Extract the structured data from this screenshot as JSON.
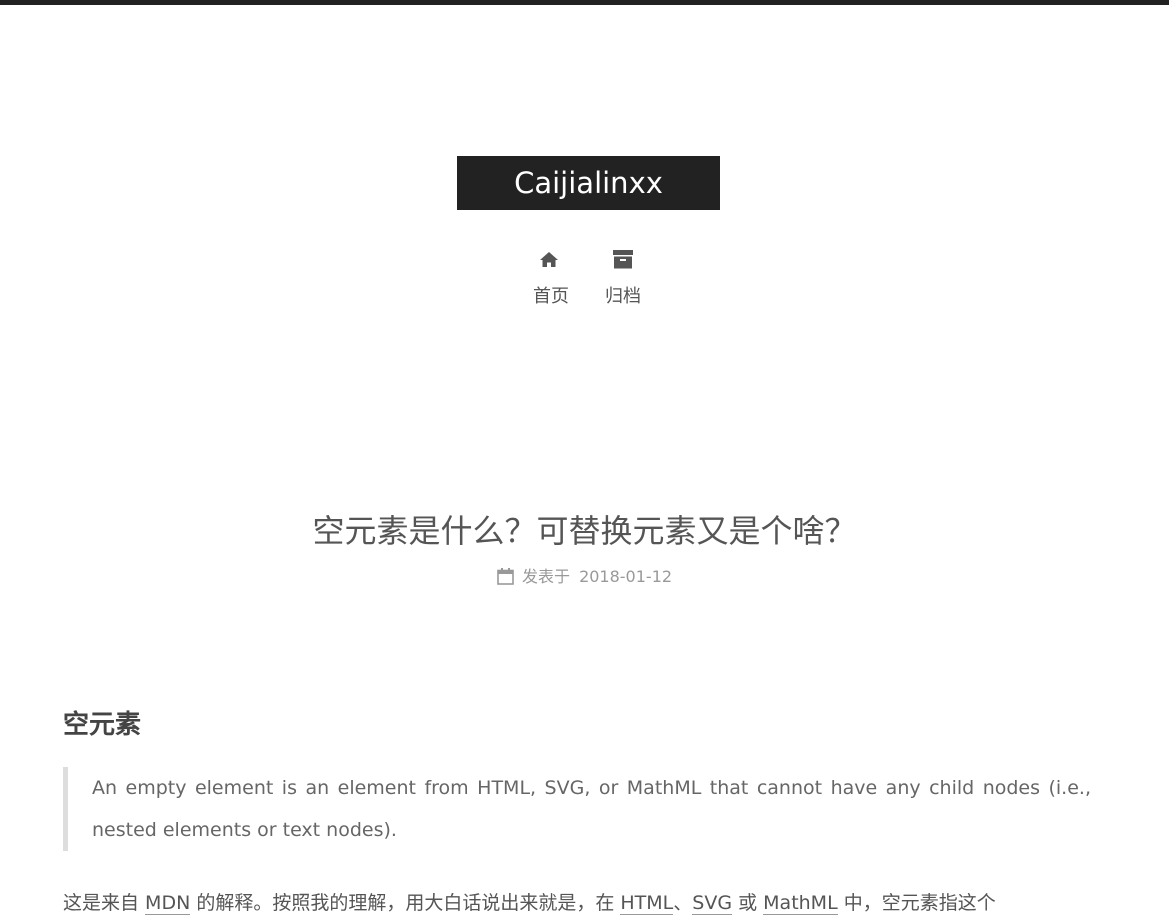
{
  "site": {
    "brand": "Caijialinxx"
  },
  "menu": {
    "items": [
      {
        "label": "首页",
        "icon": "home-icon"
      },
      {
        "label": "归档",
        "icon": "archive-icon"
      }
    ]
  },
  "post": {
    "title": "空元素是什么？可替换元素又是个啥？",
    "meta_label": "发表于",
    "date": "2018-01-12",
    "section_heading": "空元素",
    "blockquote": "An empty element is an element from HTML, SVG, or MathML that cannot have any child nodes (i.e., nested elements or text nodes).",
    "paragraph": {
      "t1": "这是来自 ",
      "link_mdn": "MDN",
      "t2": " 的解释。按照我的理解，用大白话说出来就是，在 ",
      "link_html": "HTML",
      "t3": "、",
      "link_svg": "SVG",
      "t4": " 或 ",
      "link_mathml": "MathML",
      "t5": " 中，空元素指这个"
    }
  },
  "colors": {
    "accent_dark": "#222222",
    "text": "#555555",
    "meta": "#999999"
  }
}
